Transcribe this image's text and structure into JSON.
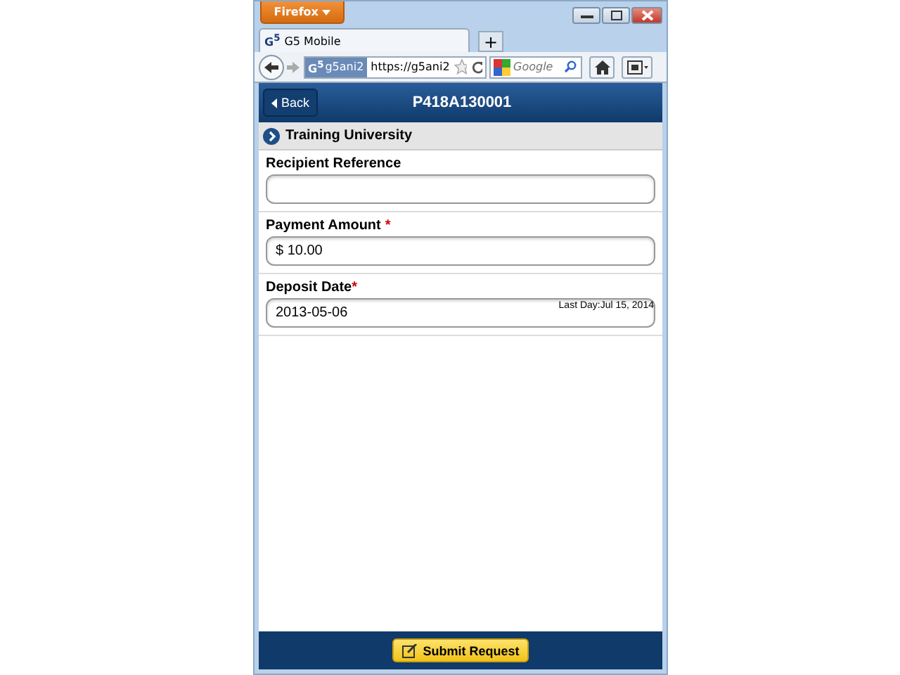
{
  "browser": {
    "app_menu": "Firefox",
    "tab": {
      "logo": "G$^{5}$",
      "title": "G5 Mobile"
    },
    "new_tab": "+",
    "site_badge": {
      "logo": "G$^{5}$",
      "name": "g5ani2"
    },
    "url": "https://g5ani2",
    "search": {
      "placeholder": "Google"
    }
  },
  "header": {
    "back": "Back",
    "title": "P418A130001"
  },
  "section": {
    "title": "Training University"
  },
  "fields": [
    {
      "label": "Recipient Reference"
    },
    {
      "label": "Payment Amount",
      "required_mark": "*",
      "spaced": true,
      "value": "$ 10.00"
    },
    {
      "label": "Deposit Date",
      "required_mark": "*",
      "spaced": false,
      "value": "2013-05-06",
      "note": "Last Day:Jul 15, 2014"
    }
  ],
  "submit": "Submit Request"
}
